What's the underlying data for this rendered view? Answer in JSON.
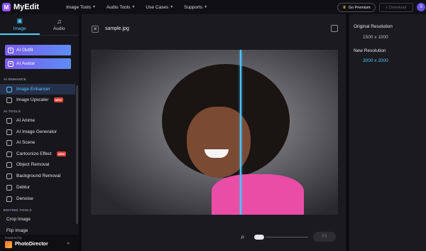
{
  "app": {
    "logo_glyph": "M",
    "name": "MyEdit"
  },
  "nav": [
    "Image Tools",
    "Audio Tools",
    "Use Cases",
    "Supports"
  ],
  "header": {
    "premium_label": "Go Premium",
    "download_label": "Download",
    "avatar_letter": "S"
  },
  "tabs": [
    {
      "label": "Image",
      "active": true
    },
    {
      "label": "Audio",
      "active": false
    }
  ],
  "ai_buttons": [
    "AI Outfit",
    "AI Avatar"
  ],
  "sections": {
    "enhance": "AI ENHANCE",
    "tools": "AI TOOLS",
    "editing": "EDITING TOOLS"
  },
  "enhance_items": [
    {
      "label": "Image Enhancer",
      "active": true,
      "badge": ""
    },
    {
      "label": "Image Upscaler",
      "active": false,
      "badge": "NEW"
    }
  ],
  "tool_items": [
    {
      "label": "AI Anime",
      "badge": ""
    },
    {
      "label": "AI Image Generator",
      "badge": ""
    },
    {
      "label": "AI Scene",
      "badge": ""
    },
    {
      "label": "Cartoonize Effect",
      "badge": "NEW"
    },
    {
      "label": "Object Removal",
      "badge": ""
    },
    {
      "label": "Background Removal",
      "badge": ""
    },
    {
      "label": "Deblur",
      "badge": ""
    },
    {
      "label": "Denoise",
      "badge": ""
    }
  ],
  "editing_items": [
    "Crop Image",
    "Flip Image"
  ],
  "powered": {
    "by": "Powered by",
    "name": "PhotoDirector"
  },
  "main": {
    "filename": "sample.jpg",
    "fit_label": "Fit"
  },
  "info": {
    "original_label": "Original Resolution",
    "original_value": "1500 x 1000",
    "new_label": "New Resolution",
    "new_value": "3000 x 2000"
  },
  "colors": {
    "accent": "#4fc3ff",
    "brand": "#6a5cff",
    "badge_new": "#e0413a"
  }
}
